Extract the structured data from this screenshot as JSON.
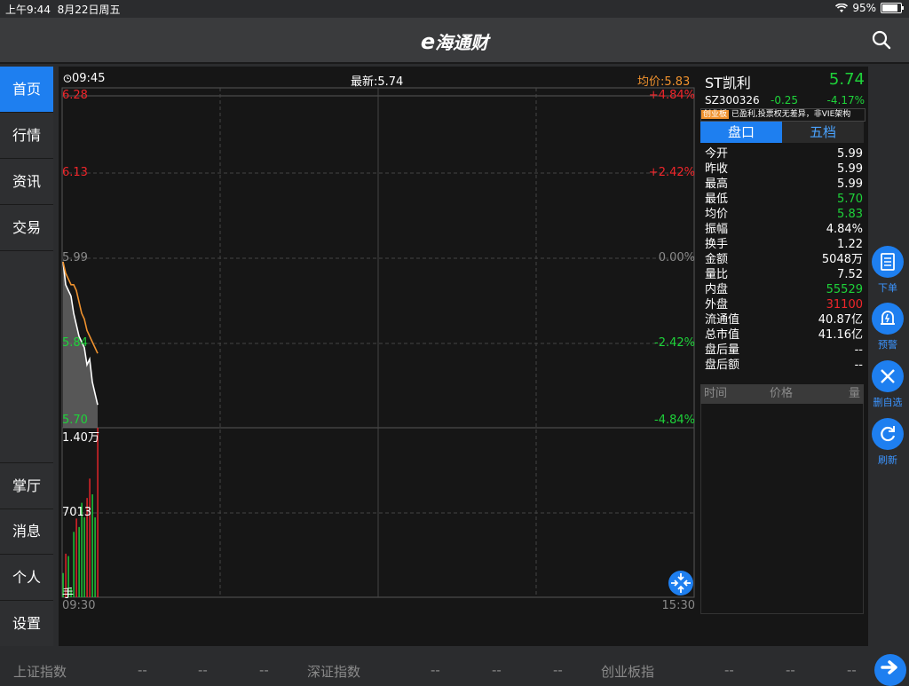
{
  "status_bar": {
    "time": "上午9:44",
    "date": "8月22日周五",
    "battery": "95%"
  },
  "nav": {
    "logo_prefix": "e",
    "logo_text": "海通财"
  },
  "sidebar": {
    "top_items": [
      {
        "label": "首页"
      },
      {
        "label": "行情"
      },
      {
        "label": "资讯"
      },
      {
        "label": "交易"
      }
    ],
    "bottom_items": [
      {
        "label": "掌厅"
      },
      {
        "label": "消息"
      },
      {
        "label": "个人"
      },
      {
        "label": "设置"
      }
    ]
  },
  "chart": {
    "clock_time": "09:45",
    "latest_label": "最新:5.74",
    "avg_label": "均价:5.83",
    "price_levels": [
      "6.28",
      "6.13",
      "5.99",
      "5.84",
      "5.70"
    ],
    "pct_levels": [
      "+4.84%",
      "+2.42%",
      "0.00%",
      "-2.42%",
      "-4.84%"
    ],
    "volume_max": "1.40万",
    "volume_mid": "7013",
    "volume_unit": "手",
    "time_start": "09:30",
    "time_end": "15:30"
  },
  "chart_data": {
    "type": "line",
    "title": "",
    "xlabel": "",
    "ylabel": "",
    "ylim": [
      5.7,
      6.28
    ],
    "reference_price": 5.99,
    "series": [
      {
        "name": "最新",
        "values": [
          5.99,
          5.95,
          5.94,
          5.93,
          5.9,
          5.88,
          5.86,
          5.85,
          5.84,
          5.81,
          5.82,
          5.78,
          5.76,
          5.74
        ]
      },
      {
        "name": "均价",
        "values": [
          5.99,
          5.97,
          5.96,
          5.95,
          5.95,
          5.94,
          5.92,
          5.9,
          5.89,
          5.87,
          5.86,
          5.85,
          5.84,
          5.83
        ]
      }
    ],
    "volume": [
      2000,
      3600,
      3400,
      800,
      5400,
      6500,
      5800,
      7800,
      6600,
      8200,
      9800,
      8500,
      6600,
      14000
    ]
  },
  "stock": {
    "name": "ST凯利",
    "price": "5.74",
    "code": "SZ300326",
    "change": "-0.25",
    "change_pct": "-4.17%",
    "board_tag": "创业板",
    "board_info": "已盈利,投票权无差异，非VIE架构"
  },
  "tabs": {
    "active": "盘口",
    "inactive": "五档"
  },
  "quote_rows": [
    {
      "label": "今开",
      "value": "5.99",
      "color": "white"
    },
    {
      "label": "昨收",
      "value": "5.99",
      "color": "white"
    },
    {
      "label": "最高",
      "value": "5.99",
      "color": "white"
    },
    {
      "label": "最低",
      "value": "5.70",
      "color": "green"
    },
    {
      "label": "均价",
      "value": "5.83",
      "color": "green"
    },
    {
      "label": "振幅",
      "value": "4.84%",
      "color": "white"
    },
    {
      "label": "换手",
      "value": "1.22",
      "color": "white"
    },
    {
      "label": "金额",
      "value": "5048万",
      "color": "white"
    },
    {
      "label": "量比",
      "value": "7.52",
      "color": "white"
    },
    {
      "label": "内盘",
      "value": "55529",
      "color": "green"
    },
    {
      "label": "外盘",
      "value": "31100",
      "color": "red"
    },
    {
      "label": "流通值",
      "value": "40.87亿",
      "color": "white"
    },
    {
      "label": "总市值",
      "value": "41.16亿",
      "color": "white"
    },
    {
      "label": "盘后量",
      "value": "--",
      "color": "white"
    },
    {
      "label": "盘后额",
      "value": "--",
      "color": "white"
    }
  ],
  "trades_header": {
    "time": "时间",
    "price": "价格",
    "volume": "量"
  },
  "actions": [
    {
      "label": "下单"
    },
    {
      "label": "预警"
    },
    {
      "label": "删自选"
    },
    {
      "label": "刷新"
    }
  ],
  "ticker": [
    {
      "name": "上证指数",
      "v1": "--",
      "v2": "--",
      "v3": "--"
    },
    {
      "name": "深证指数",
      "v1": "--",
      "v2": "--",
      "v3": "--"
    },
    {
      "name": "创业板指",
      "v1": "--",
      "v2": "--",
      "v3": "--"
    }
  ],
  "colors": {
    "accent": "#1e7ff0",
    "up": "#f0262b",
    "down": "#1ed33a",
    "avg_line": "#f0922e"
  }
}
